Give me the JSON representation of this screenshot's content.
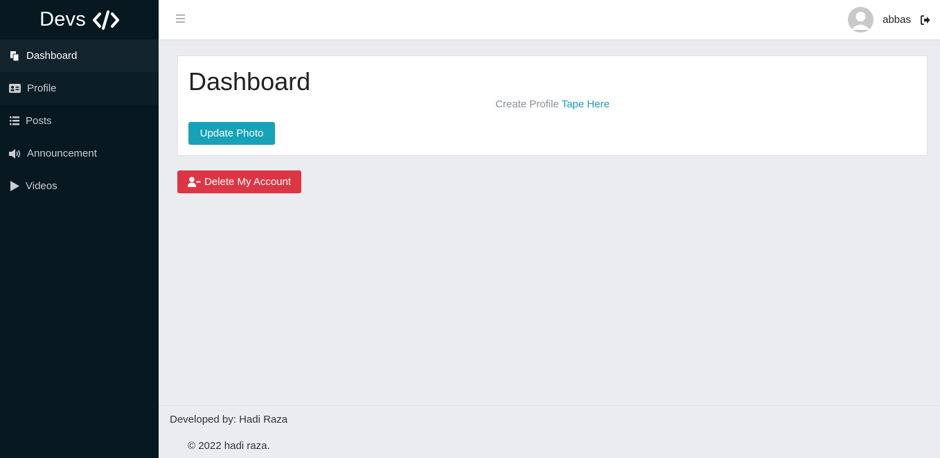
{
  "brand": {
    "name": "Devs",
    "icon": "code-icon"
  },
  "sidebar": {
    "items": [
      {
        "label": "Dashboard",
        "icon": "copy-icon",
        "active": true
      },
      {
        "label": "Profile",
        "icon": "id-card-icon"
      },
      {
        "label": "Posts",
        "icon": "list-icon"
      },
      {
        "label": "Announcement",
        "icon": "volume-icon"
      },
      {
        "label": "Videos",
        "icon": "play-icon"
      }
    ]
  },
  "topbar": {
    "menu_icon": "hamburger-icon",
    "username": "abbas",
    "logout_icon": "sign-out-icon"
  },
  "main": {
    "title": "Dashboard",
    "create_profile_text": "Create Profile",
    "create_profile_link": "Tape Here",
    "update_photo_label": "Update Photo",
    "delete_account_label": "Delete My Account"
  },
  "footer": {
    "developed_by": "Developed by: Hadi Raza",
    "copyright": "© 2022 hadi raza."
  },
  "colors": {
    "sidebar": "#081820",
    "info": "#17a2b8",
    "danger": "#dc3545",
    "background": "#ebecef"
  }
}
